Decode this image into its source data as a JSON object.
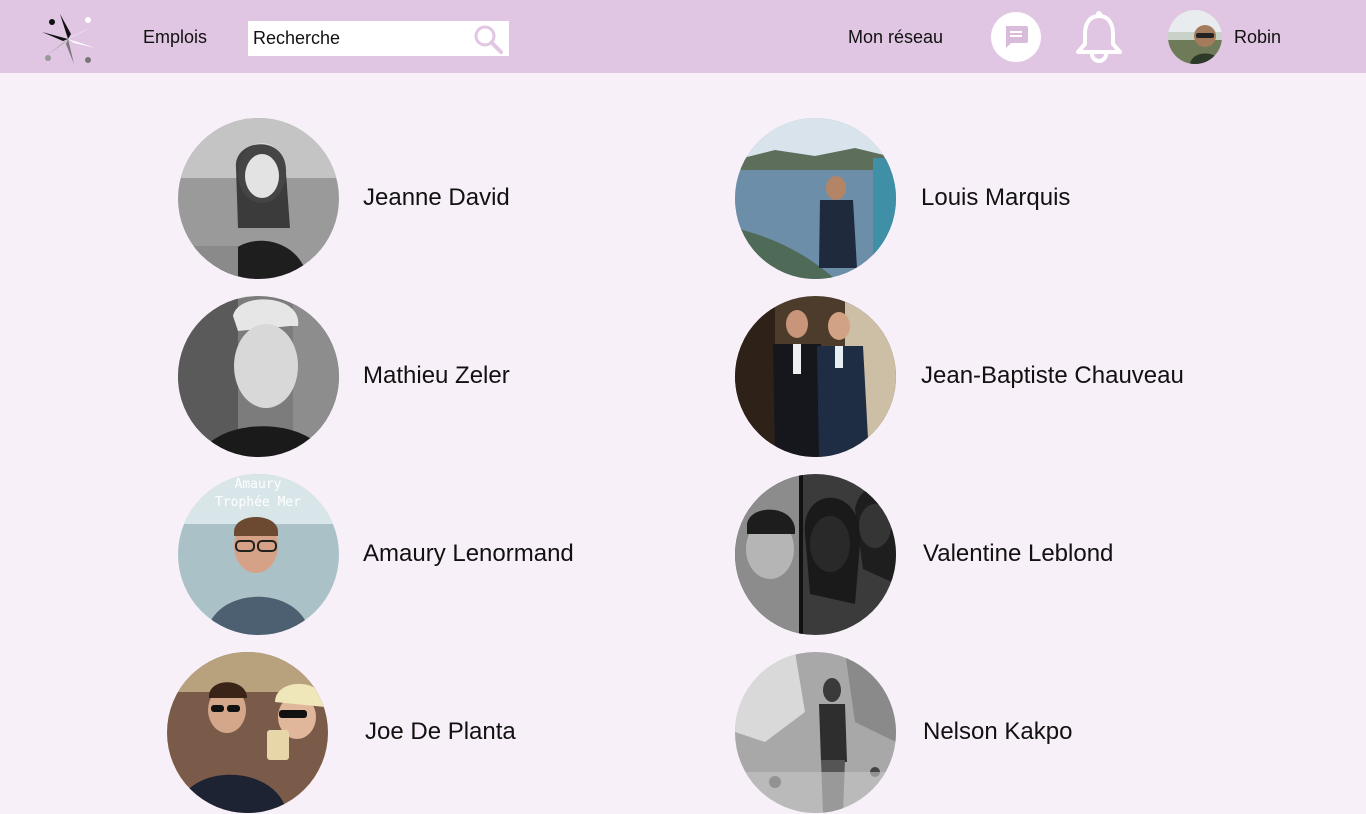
{
  "header": {
    "jobs_label": "Emplois",
    "search_placeholder": "Recherche",
    "network_label": "Mon réseau",
    "user_name": "Robin"
  },
  "people": [
    {
      "name": "Jeanne David"
    },
    {
      "name": "Louis Marquis"
    },
    {
      "name": "Mathieu Zeler"
    },
    {
      "name": "Jean-Baptiste Chauveau"
    },
    {
      "name": "Amaury Lenormand"
    },
    {
      "name": "Valentine Leblond"
    },
    {
      "name": "Joe De Planta"
    },
    {
      "name": "Nelson Kakpo"
    }
  ],
  "photo_texts": {
    "amaury_line1": "Amaury",
    "amaury_line2": "Trophée Mer"
  },
  "colors": {
    "header_bg": "#e0c6e2",
    "page_bg": "#f8f0f8",
    "icon_fill": "#ffffff",
    "chat_glyph": "#d9bcdc"
  },
  "icons": {
    "logo": "compass-star-logo-icon",
    "search": "search-icon",
    "messages": "chat-bubble-icon",
    "notifications": "bell-icon"
  }
}
